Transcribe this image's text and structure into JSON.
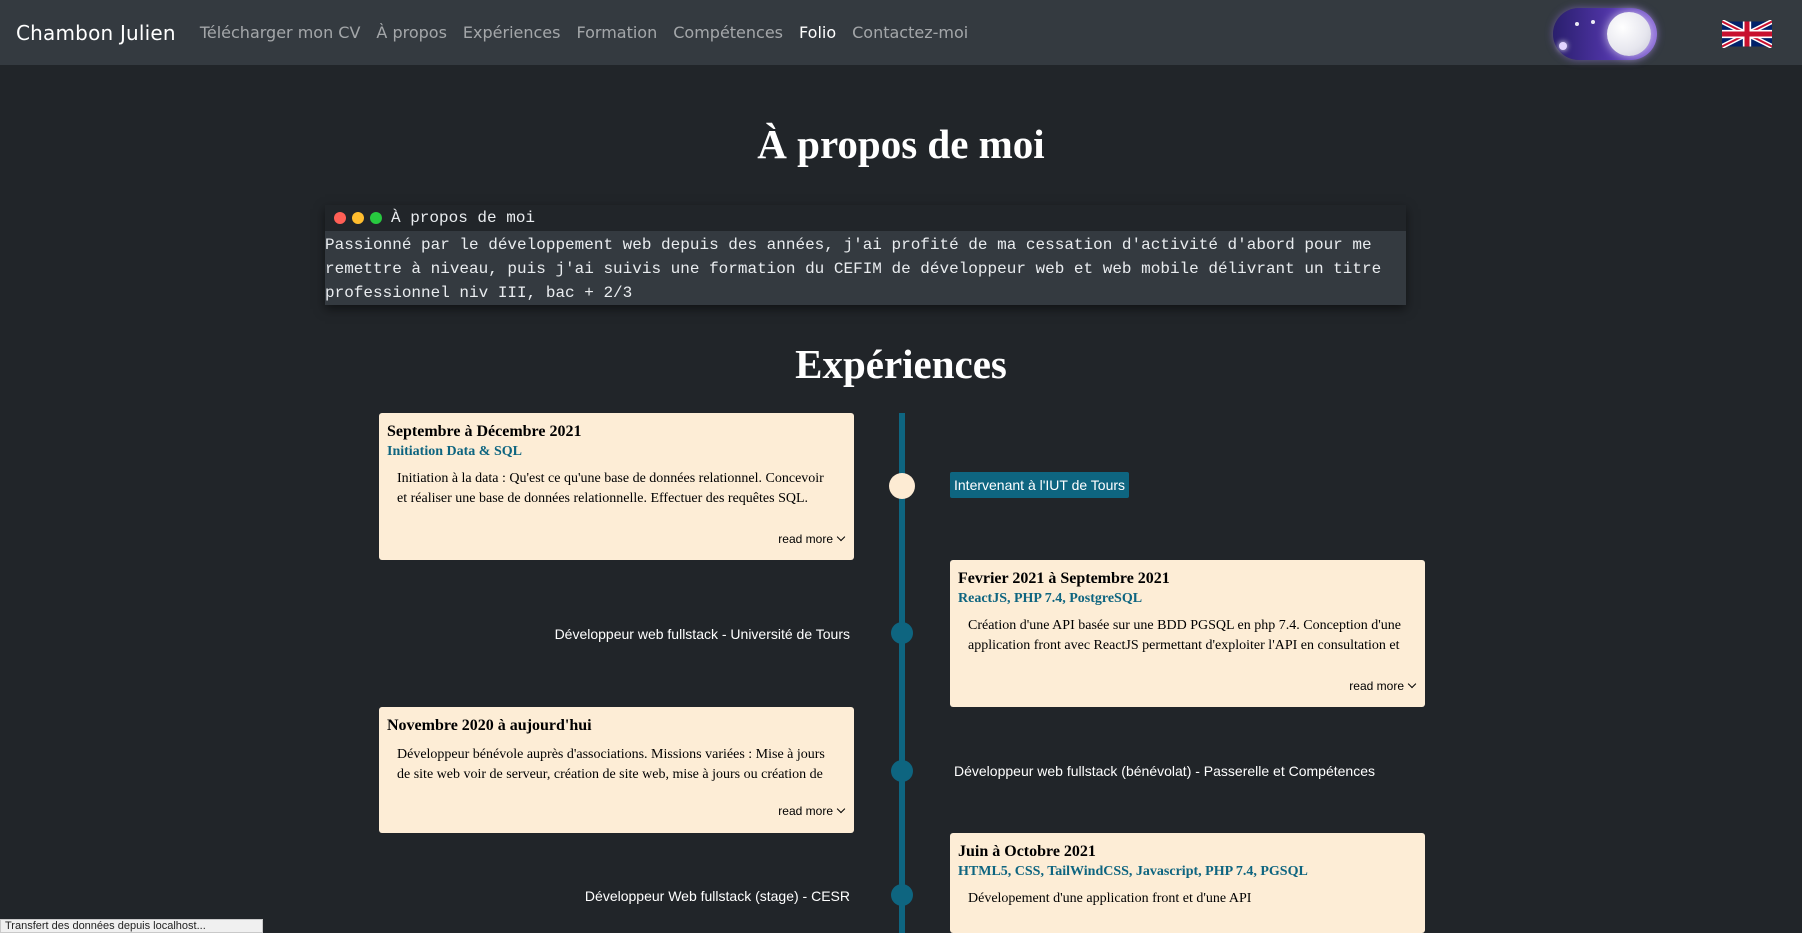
{
  "nav": {
    "brand": "Chambon Julien",
    "links": [
      {
        "label": "Télécharger mon CV"
      },
      {
        "label": "À propos"
      },
      {
        "label": "Expériences"
      },
      {
        "label": "Formation"
      },
      {
        "label": "Compétences"
      },
      {
        "label": "Folio",
        "active": true
      },
      {
        "label": "Contactez-moi"
      }
    ],
    "theme_toggle_icon": "moon-toggle-icon",
    "language_icon": "uk-flag-icon"
  },
  "about": {
    "heading": "À propos de moi",
    "terminal_title": "À propos de moi",
    "terminal_lines": [
      "Passionné par le développement web depuis des années, j'ai profité de ma cessation d'activité d'abord pour me",
      "remettre à niveau, puis j'ai suivis une formation du CEFIM de développeur web et web mobile délivrant un titre",
      "professionnel niv III, bac + 2/3"
    ],
    "dot_colors": [
      "#ff5f56",
      "#ffbd2e",
      "#27c93f"
    ]
  },
  "experiences": {
    "heading": "Expériences",
    "read_more": "read more",
    "items": [
      {
        "period": "Septembre à Décembre 2021",
        "tech": "Initiation Data & SQL",
        "text": "Initiation à la data : Qu'est ce qu'une base de données relationnel. Concevoir et réaliser une base de données relationnelle. Effectuer des requêtes SQL. Algèbre SQL",
        "role": "Intervenant à l'IUT de Tours"
      },
      {
        "period": "Fevrier 2021 à Septembre 2021",
        "tech": "ReactJS, PHP 7.4, PostgreSQL",
        "text": "Création d'une API basée sur une BDD PGSQL en php 7.4. Conception d'une application front avec ReactJS permettant d'exploiter l'API en consultation et insertion de data. Modification de la BDD existante et de l'API en conséquence",
        "role": "Développeur web fullstack - Université de Tours"
      },
      {
        "period": "Novembre 2020 à aujourd'hui",
        "tech": "",
        "text": "Développeur bénévole auprès d'associations. Missions variées : Mise à jours de site web voir de serveur, création de site web, mise à jours ou création de plugin pour les sites wordpress, et formation aux bénévoles à l'utilisation d'outils",
        "role": "Développeur web fullstack (bénévolat) - Passerelle et Compétences"
      },
      {
        "period": "Juin à Octobre 2021",
        "tech": "HTML5, CSS, TailWindCSS, Javascript, PHP 7.4, PGSQL",
        "text": "Dévelopement d'une application front et d'une API",
        "role": "Développeur Web fullstack (stage) - CESR"
      }
    ],
    "accent_color": "#0e6580",
    "card_color": "#fdedd6"
  },
  "status_bar": "Transfert des données depuis localhost..."
}
